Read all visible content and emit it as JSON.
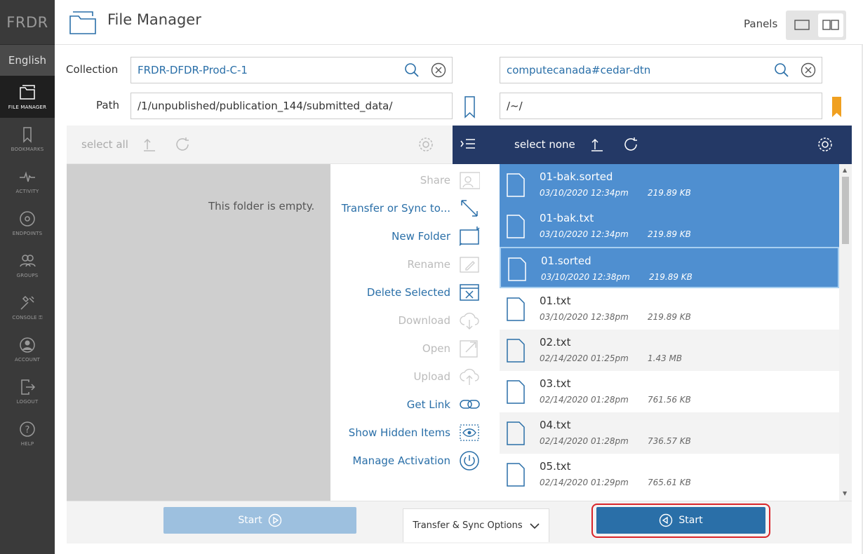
{
  "app": {
    "brand": "FRDR",
    "language": "English",
    "title": "File Manager"
  },
  "sidebar": {
    "items": [
      {
        "label": "FILE MANAGER",
        "icon": "folder-icon"
      },
      {
        "label": "BOOKMARKS",
        "icon": "bookmark-icon"
      },
      {
        "label": "ACTIVITY",
        "icon": "activity-icon"
      },
      {
        "label": "ENDPOINTS",
        "icon": "endpoints-icon"
      },
      {
        "label": "GROUPS",
        "icon": "groups-icon"
      },
      {
        "label": "CONSOLE ⚿",
        "icon": "console-icon"
      },
      {
        "label": "ACCOUNT",
        "icon": "account-icon"
      },
      {
        "label": "LOGOUT",
        "icon": "logout-icon"
      },
      {
        "label": "HELP",
        "icon": "help-icon"
      }
    ]
  },
  "header": {
    "panels_label": "Panels"
  },
  "left": {
    "collection_label": "Collection",
    "collection": "FRDR-DFDR-Prod-C-1",
    "path_label": "Path",
    "path": "/1/unpublished/publication_144/submitted_data/",
    "select_all": "select all",
    "empty": "This folder is empty."
  },
  "right": {
    "collection": "computecanada#cedar-dtn",
    "path": "/~/",
    "select_none": "select none"
  },
  "actions": [
    {
      "label": "Share",
      "enabled": false
    },
    {
      "label": "Transfer or Sync to...",
      "enabled": true
    },
    {
      "label": "New Folder",
      "enabled": true
    },
    {
      "label": "Rename",
      "enabled": false
    },
    {
      "label": "Delete Selected",
      "enabled": true
    },
    {
      "label": "Download",
      "enabled": false
    },
    {
      "label": "Open",
      "enabled": false
    },
    {
      "label": "Upload",
      "enabled": false
    },
    {
      "label": "Get Link",
      "enabled": true
    },
    {
      "label": "Show Hidden Items",
      "enabled": true
    },
    {
      "label": "Manage Activation",
      "enabled": true
    }
  ],
  "files": [
    {
      "name": "01-bak.sorted",
      "date": "03/10/2020 12:34pm",
      "size": "219.89 KB",
      "selected": true
    },
    {
      "name": "01-bak.txt",
      "date": "03/10/2020 12:34pm",
      "size": "219.89 KB",
      "selected": true
    },
    {
      "name": "01.sorted",
      "date": "03/10/2020 12:38pm",
      "size": "219.89 KB",
      "selected": true
    },
    {
      "name": "01.txt",
      "date": "03/10/2020 12:38pm",
      "size": "219.89 KB",
      "selected": false
    },
    {
      "name": "02.txt",
      "date": "02/14/2020 01:25pm",
      "size": "1.43 MB",
      "selected": false
    },
    {
      "name": "03.txt",
      "date": "02/14/2020 01:28pm",
      "size": "761.56 KB",
      "selected": false
    },
    {
      "name": "04.txt",
      "date": "02/14/2020 01:28pm",
      "size": "736.57 KB",
      "selected": false
    },
    {
      "name": "05.txt",
      "date": "02/14/2020 01:29pm",
      "size": "765.61 KB",
      "selected": false
    }
  ],
  "bottom": {
    "start_left": "Start",
    "options": "Transfer & Sync Options",
    "start_right": "Start"
  },
  "colors": {
    "accent": "#2a6fa8",
    "selected": "#4f8fd0",
    "toolbar_dark": "#243966",
    "highlight": "#d9262b"
  }
}
